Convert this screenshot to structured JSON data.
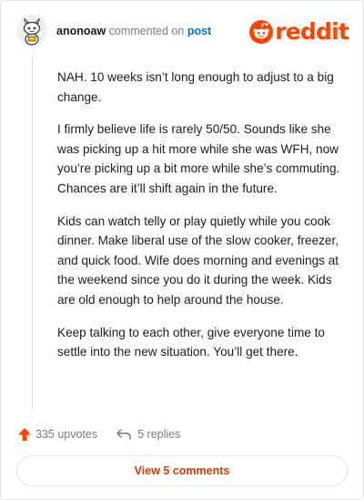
{
  "header": {
    "username": "anonoaw",
    "action_text": "commented on",
    "target_label": "post",
    "brand_wordmark": "reddit",
    "avatar_icon": "snoo-avatar-icon",
    "logo_icon": "reddit-logo-icon"
  },
  "comment": {
    "paragraphs": [
      "NAH. 10 weeks isn’t long enough to adjust to a big change.",
      "I firmly believe life is rarely 50/50. Sounds like she was picking up a hit more while she was WFH, now you’re picking up a bit more while she’s commuting. Chances are it’ll shift again in the future.",
      "Kids can watch telly or play quietly while you cook dinner. Make liberal use of the slow cooker, freezer, and quick food. Wife does morning and evenings at the weekend since you do it during the week. Kids are old enough to help around the house.",
      "Keep talking to each other, give everyone time to settle into the new situation. You’ll get there."
    ]
  },
  "actions": {
    "upvotes_label": "335 upvotes",
    "replies_label": "5 replies",
    "upvote_icon": "upvote-arrow-icon",
    "reply_icon": "reply-arrow-icon"
  },
  "footer": {
    "view_comments_label": "View 5 comments"
  },
  "colors": {
    "brand_orange": "#ff4500",
    "upvote_orange": "#ff4500",
    "link_blue": "#0079d3",
    "view_comments_text": "#d93a00",
    "muted_gray": "#7c7c7c"
  }
}
